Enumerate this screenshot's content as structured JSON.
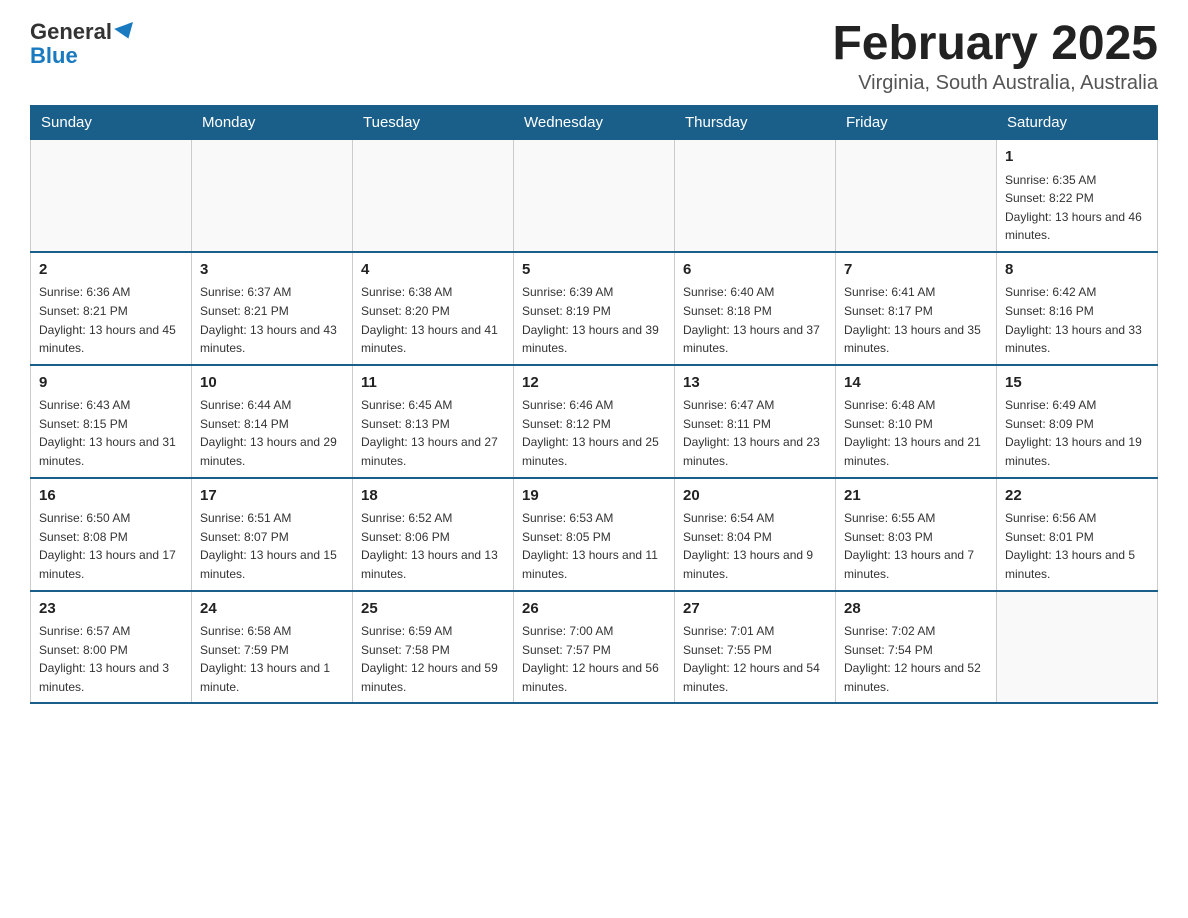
{
  "logo": {
    "general": "General",
    "blue": "Blue"
  },
  "title": "February 2025",
  "subtitle": "Virginia, South Australia, Australia",
  "weekdays": [
    "Sunday",
    "Monday",
    "Tuesday",
    "Wednesday",
    "Thursday",
    "Friday",
    "Saturday"
  ],
  "weeks": [
    [
      {
        "day": "",
        "info": ""
      },
      {
        "day": "",
        "info": ""
      },
      {
        "day": "",
        "info": ""
      },
      {
        "day": "",
        "info": ""
      },
      {
        "day": "",
        "info": ""
      },
      {
        "day": "",
        "info": ""
      },
      {
        "day": "1",
        "info": "Sunrise: 6:35 AM\nSunset: 8:22 PM\nDaylight: 13 hours and 46 minutes."
      }
    ],
    [
      {
        "day": "2",
        "info": "Sunrise: 6:36 AM\nSunset: 8:21 PM\nDaylight: 13 hours and 45 minutes."
      },
      {
        "day": "3",
        "info": "Sunrise: 6:37 AM\nSunset: 8:21 PM\nDaylight: 13 hours and 43 minutes."
      },
      {
        "day": "4",
        "info": "Sunrise: 6:38 AM\nSunset: 8:20 PM\nDaylight: 13 hours and 41 minutes."
      },
      {
        "day": "5",
        "info": "Sunrise: 6:39 AM\nSunset: 8:19 PM\nDaylight: 13 hours and 39 minutes."
      },
      {
        "day": "6",
        "info": "Sunrise: 6:40 AM\nSunset: 8:18 PM\nDaylight: 13 hours and 37 minutes."
      },
      {
        "day": "7",
        "info": "Sunrise: 6:41 AM\nSunset: 8:17 PM\nDaylight: 13 hours and 35 minutes."
      },
      {
        "day": "8",
        "info": "Sunrise: 6:42 AM\nSunset: 8:16 PM\nDaylight: 13 hours and 33 minutes."
      }
    ],
    [
      {
        "day": "9",
        "info": "Sunrise: 6:43 AM\nSunset: 8:15 PM\nDaylight: 13 hours and 31 minutes."
      },
      {
        "day": "10",
        "info": "Sunrise: 6:44 AM\nSunset: 8:14 PM\nDaylight: 13 hours and 29 minutes."
      },
      {
        "day": "11",
        "info": "Sunrise: 6:45 AM\nSunset: 8:13 PM\nDaylight: 13 hours and 27 minutes."
      },
      {
        "day": "12",
        "info": "Sunrise: 6:46 AM\nSunset: 8:12 PM\nDaylight: 13 hours and 25 minutes."
      },
      {
        "day": "13",
        "info": "Sunrise: 6:47 AM\nSunset: 8:11 PM\nDaylight: 13 hours and 23 minutes."
      },
      {
        "day": "14",
        "info": "Sunrise: 6:48 AM\nSunset: 8:10 PM\nDaylight: 13 hours and 21 minutes."
      },
      {
        "day": "15",
        "info": "Sunrise: 6:49 AM\nSunset: 8:09 PM\nDaylight: 13 hours and 19 minutes."
      }
    ],
    [
      {
        "day": "16",
        "info": "Sunrise: 6:50 AM\nSunset: 8:08 PM\nDaylight: 13 hours and 17 minutes."
      },
      {
        "day": "17",
        "info": "Sunrise: 6:51 AM\nSunset: 8:07 PM\nDaylight: 13 hours and 15 minutes."
      },
      {
        "day": "18",
        "info": "Sunrise: 6:52 AM\nSunset: 8:06 PM\nDaylight: 13 hours and 13 minutes."
      },
      {
        "day": "19",
        "info": "Sunrise: 6:53 AM\nSunset: 8:05 PM\nDaylight: 13 hours and 11 minutes."
      },
      {
        "day": "20",
        "info": "Sunrise: 6:54 AM\nSunset: 8:04 PM\nDaylight: 13 hours and 9 minutes."
      },
      {
        "day": "21",
        "info": "Sunrise: 6:55 AM\nSunset: 8:03 PM\nDaylight: 13 hours and 7 minutes."
      },
      {
        "day": "22",
        "info": "Sunrise: 6:56 AM\nSunset: 8:01 PM\nDaylight: 13 hours and 5 minutes."
      }
    ],
    [
      {
        "day": "23",
        "info": "Sunrise: 6:57 AM\nSunset: 8:00 PM\nDaylight: 13 hours and 3 minutes."
      },
      {
        "day": "24",
        "info": "Sunrise: 6:58 AM\nSunset: 7:59 PM\nDaylight: 13 hours and 1 minute."
      },
      {
        "day": "25",
        "info": "Sunrise: 6:59 AM\nSunset: 7:58 PM\nDaylight: 12 hours and 59 minutes."
      },
      {
        "day": "26",
        "info": "Sunrise: 7:00 AM\nSunset: 7:57 PM\nDaylight: 12 hours and 56 minutes."
      },
      {
        "day": "27",
        "info": "Sunrise: 7:01 AM\nSunset: 7:55 PM\nDaylight: 12 hours and 54 minutes."
      },
      {
        "day": "28",
        "info": "Sunrise: 7:02 AM\nSunset: 7:54 PM\nDaylight: 12 hours and 52 minutes."
      },
      {
        "day": "",
        "info": ""
      }
    ]
  ]
}
